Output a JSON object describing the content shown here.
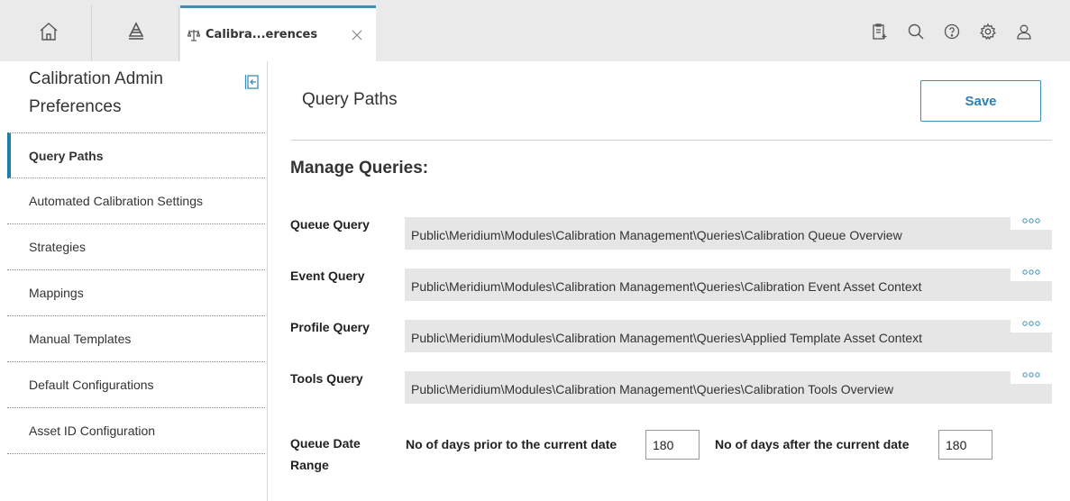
{
  "tab": {
    "label": "Calibra...erences"
  },
  "sidebar": {
    "title": "Calibration Admin Preferences",
    "items": [
      {
        "label": "Query Paths",
        "active": true
      },
      {
        "label": "Automated Calibration Settings",
        "active": false
      },
      {
        "label": "Strategies",
        "active": false
      },
      {
        "label": "Mappings",
        "active": false
      },
      {
        "label": "Manual Templates",
        "active": false
      },
      {
        "label": "Default Configurations",
        "active": false
      },
      {
        "label": "Asset ID Configuration",
        "active": false
      }
    ]
  },
  "main": {
    "title": "Query Paths",
    "save_label": "Save",
    "section_heading": "Manage Queries:",
    "queries": [
      {
        "label": "Queue Query",
        "value": "Public\\Meridium\\Modules\\Calibration Management\\Queries\\Calibration Queue Overview"
      },
      {
        "label": "Event Query",
        "value": "Public\\Meridium\\Modules\\Calibration Management\\Queries\\Calibration Event Asset Context"
      },
      {
        "label": "Profile Query",
        "value": "Public\\Meridium\\Modules\\Calibration Management\\Queries\\Applied Template Asset Context"
      },
      {
        "label": "Tools Query",
        "value": "Public\\Meridium\\Modules\\Calibration Management\\Queries\\Calibration Tools Overview"
      }
    ],
    "date_range": {
      "label_line1": "Queue Date",
      "label_line2": "Range",
      "prior_label": "No of days prior to the current date",
      "prior_value": "180",
      "after_label": "No of days after the current date",
      "after_value": "180"
    }
  },
  "icons": {
    "home": "home-icon",
    "asset": "asset-hierarchy-icon",
    "tab": "scale-icon",
    "close": "close-icon",
    "clipboard": "clipboard-icon",
    "search": "search-icon",
    "help": "help-icon",
    "settings": "gear-icon",
    "user": "user-icon",
    "collapse": "collapse-sidebar-icon",
    "more": "more-options-icon"
  },
  "colors": {
    "accent": "#1e7ea3",
    "save_text": "#2f7fb0",
    "field_bg": "#e6e6e6",
    "topbar_bg": "#eaeaea"
  }
}
